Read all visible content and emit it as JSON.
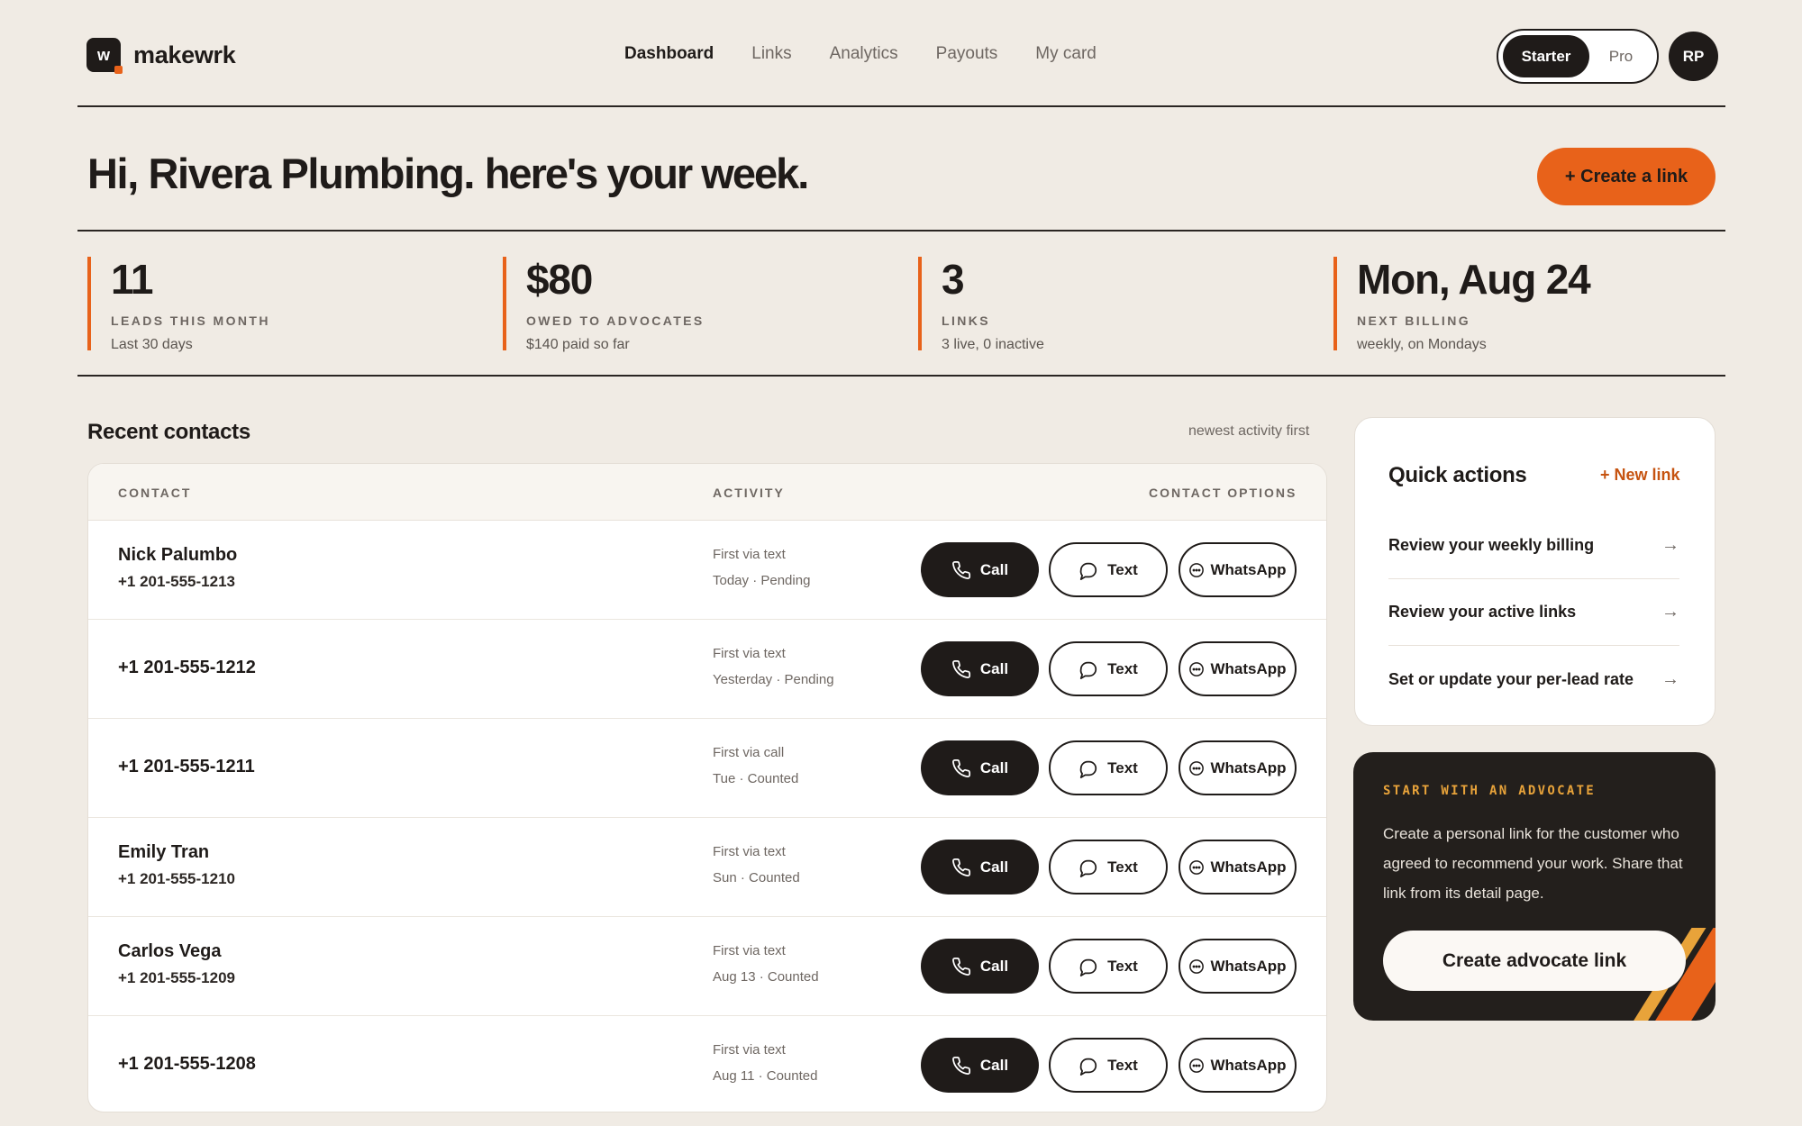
{
  "app": {
    "logo_letter": "w",
    "name": "makewrk"
  },
  "nav": {
    "items": [
      {
        "label": "Dashboard",
        "active": true
      },
      {
        "label": "Links",
        "active": false
      },
      {
        "label": "Analytics",
        "active": false
      },
      {
        "label": "Payouts",
        "active": false
      },
      {
        "label": "My card",
        "active": false
      }
    ]
  },
  "plan": {
    "selected": "Starter",
    "other": "Pro"
  },
  "user": {
    "initials": "RP"
  },
  "greeting": {
    "prefix": "Hi, Rivera Plumbing.",
    "emphasis": "here's your week."
  },
  "create_link_label": "+ Create a link",
  "stats": [
    {
      "value": "11",
      "label": "LEADS THIS MONTH",
      "sub": "Last 30 days"
    },
    {
      "value": "$80",
      "label": "OWED TO ADVOCATES",
      "sub": "$140 paid so far"
    },
    {
      "value": "3",
      "label": "LINKS",
      "sub": "3 live, 0 inactive"
    },
    {
      "value": "Mon, Aug 24",
      "label": "NEXT BILLING",
      "sub": "weekly, on Mondays"
    }
  ],
  "contacts": {
    "title": "Recent contacts",
    "sort_note": "newest activity first",
    "columns": [
      "CONTACT",
      "ACTIVITY",
      "CONTACT OPTIONS"
    ],
    "buttons": {
      "call": "Call",
      "text": "Text",
      "whatsapp": "WhatsApp"
    },
    "rows": [
      {
        "name": "Nick Palumbo",
        "phone": "+1 201-555-1213",
        "activity": "First via text",
        "status": "Today · Pending"
      },
      {
        "name": "",
        "phone": "+1 201-555-1212",
        "activity": "First via text",
        "status": "Yesterday · Pending"
      },
      {
        "name": "",
        "phone": "+1 201-555-1211",
        "activity": "First via call",
        "status": "Tue · Counted"
      },
      {
        "name": "Emily Tran",
        "phone": "+1 201-555-1210",
        "activity": "First via text",
        "status": "Sun · Counted"
      },
      {
        "name": "Carlos Vega",
        "phone": "+1 201-555-1209",
        "activity": "First via text",
        "status": "Aug 13 · Counted"
      },
      {
        "name": "",
        "phone": "+1 201-555-1208",
        "activity": "First via text",
        "status": "Aug 11 · Counted"
      }
    ]
  },
  "quick_actions": {
    "title": "Quick actions",
    "new_link": "+ New link",
    "items": [
      {
        "label": "Review your weekly billing",
        "icon": "arrow-right-icon"
      },
      {
        "label": "Review your active links",
        "icon": "arrow-right-icon"
      },
      {
        "label": "Set or update your per-lead rate",
        "icon": "arrow-right-icon"
      }
    ]
  },
  "advocate_card": {
    "kicker": "START WITH AN ADVOCATE",
    "body": "Create a personal link for the customer who agreed to recommend your work. Share that link from its detail page.",
    "button": "Create advocate link"
  },
  "colors": {
    "accent": "#e8621a",
    "background": "#f0ebe4",
    "dark": "#1f1b19",
    "kicker": "#e8a33a"
  }
}
